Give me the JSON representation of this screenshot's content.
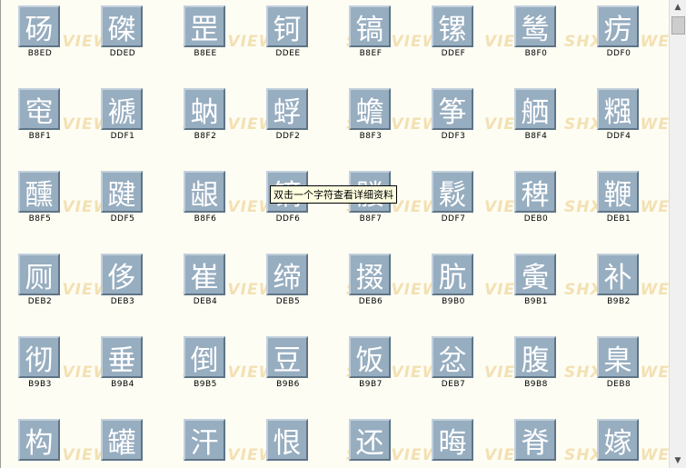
{
  "tooltip": {
    "text": "双击一个字符查看详细资料"
  },
  "watermark": {
    "text_a": "SHX VIEWER",
    "text_b": "VIEW"
  },
  "scrollbar": {
    "up_icon": "▲",
    "down_icon": "▼"
  },
  "rows": [
    [
      {
        "char": "砀",
        "code": "B8ED"
      },
      {
        "char": "磔",
        "code": "DDED"
      },
      {
        "char": "罡",
        "code": "B8EE"
      },
      {
        "char": "钶",
        "code": "DDEE"
      },
      {
        "char": "镐",
        "code": "B8EF"
      },
      {
        "char": "镙",
        "code": "DDEF"
      },
      {
        "char": "鸶",
        "code": "B8F0"
      },
      {
        "char": "疠",
        "code": "DDF0"
      }
    ],
    [
      {
        "char": "窀",
        "code": "B8F1"
      },
      {
        "char": "褫",
        "code": "DDF1"
      },
      {
        "char": "蚋",
        "code": "B8F2"
      },
      {
        "char": "蜉",
        "code": "DDF2"
      },
      {
        "char": "蟾",
        "code": "B8F3"
      },
      {
        "char": "筝",
        "code": "DDF3"
      },
      {
        "char": "舾",
        "code": "B8F4"
      },
      {
        "char": "糨",
        "code": "DDF4"
      }
    ],
    [
      {
        "char": "醺",
        "code": "B8F5"
      },
      {
        "char": "踺",
        "code": "DDF5"
      },
      {
        "char": "龈",
        "code": "B8F6"
      },
      {
        "char": "镝",
        "code": "DDF6"
      },
      {
        "char": "髅",
        "code": "B8F7"
      },
      {
        "char": "鬏",
        "code": "DDF7"
      },
      {
        "char": "稗",
        "code": "DEB0"
      },
      {
        "char": "鞭",
        "code": "DEB1"
      }
    ],
    [
      {
        "char": "厕",
        "code": "DEB2"
      },
      {
        "char": "侈",
        "code": "DEB3"
      },
      {
        "char": "崔",
        "code": "DEB4"
      },
      {
        "char": "缔",
        "code": "DEB5"
      },
      {
        "char": "掇",
        "code": "DEB6"
      },
      {
        "char": "肮",
        "code": "B9B0"
      },
      {
        "char": "夤",
        "code": "B9B1"
      },
      {
        "char": "补",
        "code": "B9B2"
      }
    ],
    [
      {
        "char": "彻",
        "code": "B9B3"
      },
      {
        "char": "垂",
        "code": "B9B4"
      },
      {
        "char": "倒",
        "code": "B9B5"
      },
      {
        "char": "豆",
        "code": "B9B6"
      },
      {
        "char": "饭",
        "code": "B9B7"
      },
      {
        "char": "忿",
        "code": "DEB7"
      },
      {
        "char": "腹",
        "code": "B9B8"
      },
      {
        "char": "臬",
        "code": "DEB8"
      }
    ],
    [
      {
        "char": "构",
        "code": ""
      },
      {
        "char": "罐",
        "code": ""
      },
      {
        "char": "汗",
        "code": ""
      },
      {
        "char": "恨",
        "code": ""
      },
      {
        "char": "还",
        "code": ""
      },
      {
        "char": "晦",
        "code": ""
      },
      {
        "char": "脊",
        "code": ""
      },
      {
        "char": "嫁",
        "code": ""
      }
    ]
  ]
}
